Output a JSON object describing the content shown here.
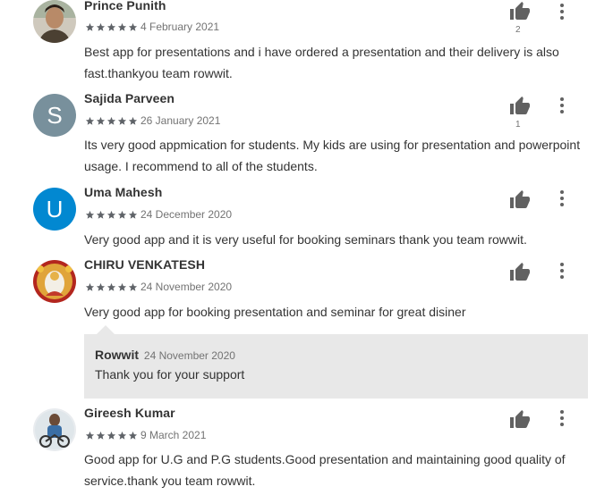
{
  "colors": {
    "star": "#5f6368",
    "thumb": "#616161",
    "avatar_s": "#78909c",
    "avatar_u": "#0288d1",
    "reply_bg": "#e8e8e8"
  },
  "reviews": [
    {
      "author": "Prince Punith",
      "rating": 5,
      "date": "4 February 2021",
      "text": "Best app for presentations and i have ordered a presentation and their delivery is also fast.thankyou team rowwit.",
      "helpful_count": "2",
      "avatar_icon": "photo-avatar"
    },
    {
      "author": "Sajida Parveen",
      "rating": 5,
      "date": "26 January 2021",
      "text": "Its very good appmication for students. My kids are using for presentation and powerpoint usage. I recommend to all of the students.",
      "helpful_count": "1",
      "avatar_letter": "S"
    },
    {
      "author": "Uma Mahesh",
      "rating": 5,
      "date": "24 December 2020",
      "text": "Very good app and it is very useful for booking seminars thank you team rowwit.",
      "avatar_letter": "U"
    },
    {
      "author": "CHIRU VENKATESH",
      "rating": 5,
      "date": "24 November 2020",
      "text": "Very good app for booking presentation and seminar for great disiner",
      "avatar_icon": "photo-avatar",
      "developer_reply": {
        "name": "Rowwit",
        "date": "24 November 2020",
        "text": "Thank you for your support"
      }
    },
    {
      "author": "Gireesh Kumar",
      "rating": 5,
      "date": "9 March 2021",
      "text": "Good app for U.G and P.G students.Good presentation and maintaining good quality of service.thank you team rowwit.",
      "avatar_icon": "photo-avatar"
    }
  ]
}
